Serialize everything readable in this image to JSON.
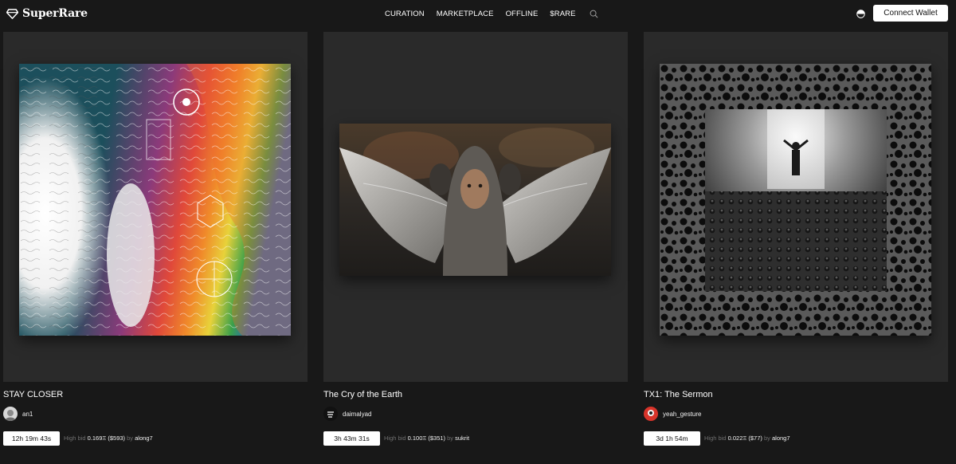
{
  "header": {
    "logo_text": "SuperRare",
    "nav": [
      "CURATION",
      "MARKETPLACE",
      "OFFLINE",
      "$RARE"
    ],
    "connect_label": "Connect Wallet",
    "icons": [
      "superrare-diamond-icon",
      "search-icon",
      "theme-toggle-icon"
    ]
  },
  "cards": [
    {
      "title": "STAY CLOSER",
      "artist": "an1",
      "timer": "12h 19m 43s",
      "bid_label": "High bid",
      "bid_amount": "0.169Ξ ($593)",
      "by_label": "by",
      "bidder": "along7"
    },
    {
      "title": "The Cry of the Earth",
      "artist": "daimalyad",
      "timer": "3h 43m 31s",
      "bid_label": "High bid",
      "bid_amount": "0.100Ξ ($351)",
      "by_label": "by",
      "bidder": "sukrit"
    },
    {
      "title": "TX1: The Sermon",
      "artist": "yeah_gesture",
      "timer": "3d 1h 54m",
      "bid_label": "High bid",
      "bid_amount": "0.022Ξ ($77)",
      "by_label": "by",
      "bidder": "along7"
    }
  ],
  "colors": {
    "background": "#181818",
    "card_panel": "#2a2a2a",
    "muted_text": "#6f6f6f",
    "button_bg": "#ffffff"
  }
}
